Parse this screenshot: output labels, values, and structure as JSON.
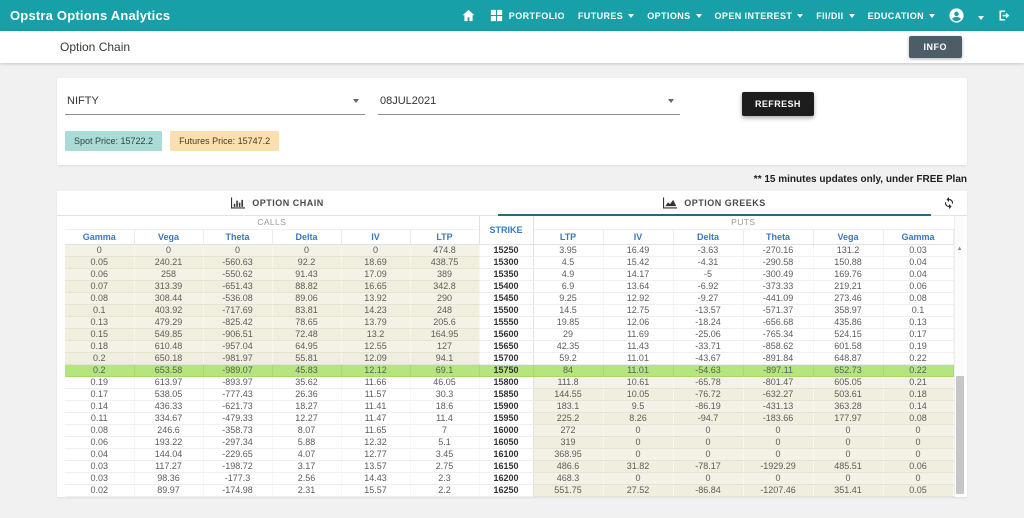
{
  "navbar": {
    "brand": "Opstra Options Analytics",
    "items": [
      {
        "label": "PORTFOLIO"
      },
      {
        "label": "FUTURES"
      },
      {
        "label": "OPTIONS"
      },
      {
        "label": "OPEN INTEREST"
      },
      {
        "label": "FII/DII"
      },
      {
        "label": "EDUCATION"
      }
    ]
  },
  "header": {
    "title": "Option Chain",
    "info_button": "INFO"
  },
  "filters": {
    "symbol": "NIFTY",
    "expiry": "08JUL2021",
    "refresh_button": "REFRESH",
    "spot_badge": "Spot Price: 15722.2",
    "futures_badge": "Futures Price: 15747.2"
  },
  "note": "** 15 minutes updates only, under FREE Plan",
  "tabs": {
    "option_chain": "OPTION CHAIN",
    "option_greeks": "OPTION GREEKS"
  },
  "table": {
    "group_headers": {
      "calls": "CALLS",
      "strike": "STRIKE",
      "puts": "PUTS"
    },
    "calls_columns": [
      "Gamma",
      "Vega",
      "Theta",
      "Delta",
      "IV",
      "LTP"
    ],
    "puts_columns": [
      "LTP",
      "IV",
      "Delta",
      "Theta",
      "Vega",
      "Gamma"
    ],
    "rows": [
      {
        "strike": "15250",
        "calls": [
          "0",
          "0",
          "0",
          "0",
          "0",
          "474.8"
        ],
        "puts": [
          "3.95",
          "16.49",
          "-3.63",
          "-270.16",
          "131.2",
          "0.03"
        ],
        "state": "calls_itm"
      },
      {
        "strike": "15300",
        "calls": [
          "0.05",
          "240.21",
          "-560.63",
          "92.2",
          "18.69",
          "438.75"
        ],
        "puts": [
          "4.5",
          "15.42",
          "-4.31",
          "-290.58",
          "150.88",
          "0.04"
        ],
        "state": "calls_itm"
      },
      {
        "strike": "15350",
        "calls": [
          "0.06",
          "258",
          "-550.62",
          "91.43",
          "17.09",
          "389"
        ],
        "puts": [
          "4.9",
          "14.17",
          "-5",
          "-300.49",
          "169.76",
          "0.04"
        ],
        "state": "calls_itm"
      },
      {
        "strike": "15400",
        "calls": [
          "0.07",
          "313.39",
          "-651.43",
          "88.82",
          "16.65",
          "342.8"
        ],
        "puts": [
          "6.9",
          "13.64",
          "-6.92",
          "-373.33",
          "219.21",
          "0.06"
        ],
        "state": "calls_itm"
      },
      {
        "strike": "15450",
        "calls": [
          "0.08",
          "308.44",
          "-536.08",
          "89.06",
          "13.92",
          "290"
        ],
        "puts": [
          "9.25",
          "12.92",
          "-9.27",
          "-441.09",
          "273.46",
          "0.08"
        ],
        "state": "calls_itm"
      },
      {
        "strike": "15500",
        "calls": [
          "0.1",
          "403.92",
          "-717.69",
          "83.81",
          "14.23",
          "248"
        ],
        "puts": [
          "14.5",
          "12.75",
          "-13.57",
          "-571.37",
          "358.97",
          "0.1"
        ],
        "state": "calls_itm"
      },
      {
        "strike": "15550",
        "calls": [
          "0.13",
          "479.29",
          "-825.42",
          "78.65",
          "13.79",
          "205.6"
        ],
        "puts": [
          "19.85",
          "12.06",
          "-18.24",
          "-656.68",
          "435.86",
          "0.13"
        ],
        "state": "calls_itm"
      },
      {
        "strike": "15600",
        "calls": [
          "0.15",
          "549.85",
          "-906.51",
          "72.48",
          "13.2",
          "164.95"
        ],
        "puts": [
          "29",
          "11.69",
          "-25.06",
          "-765.34",
          "524.15",
          "0.17"
        ],
        "state": "calls_itm"
      },
      {
        "strike": "15650",
        "calls": [
          "0.18",
          "610.48",
          "-957.04",
          "64.95",
          "12.55",
          "127"
        ],
        "puts": [
          "42.35",
          "11.43",
          "-33.71",
          "-858.62",
          "601.58",
          "0.19"
        ],
        "state": "calls_itm"
      },
      {
        "strike": "15700",
        "calls": [
          "0.2",
          "650.18",
          "-981.97",
          "55.81",
          "12.09",
          "94.1"
        ],
        "puts": [
          "59.2",
          "11.01",
          "-43.67",
          "-891.84",
          "648.87",
          "0.22"
        ],
        "state": "calls_itm"
      },
      {
        "strike": "15750",
        "calls": [
          "0.2",
          "653.58",
          "-989.07",
          "45.83",
          "12.12",
          "69.1"
        ],
        "puts": [
          "84",
          "11.01",
          "-54.63",
          "-897.11",
          "652.73",
          "0.22"
        ],
        "state": "atm"
      },
      {
        "strike": "15800",
        "calls": [
          "0.19",
          "613.97",
          "-893.97",
          "35.62",
          "11.66",
          "46.05"
        ],
        "puts": [
          "111.8",
          "10.61",
          "-65.78",
          "-801.47",
          "605.05",
          "0.21"
        ],
        "state": "puts_itm"
      },
      {
        "strike": "15850",
        "calls": [
          "0.17",
          "538.05",
          "-777.43",
          "26.36",
          "11.57",
          "30.3"
        ],
        "puts": [
          "144.55",
          "10.05",
          "-76.72",
          "-632.27",
          "503.61",
          "0.18"
        ],
        "state": "puts_itm"
      },
      {
        "strike": "15900",
        "calls": [
          "0.14",
          "436.33",
          "-621.73",
          "18.27",
          "11.41",
          "18.6"
        ],
        "puts": [
          "183.1",
          "9.5",
          "-86.19",
          "-431.13",
          "363.28",
          "0.14"
        ],
        "state": "puts_itm"
      },
      {
        "strike": "15950",
        "calls": [
          "0.11",
          "334.67",
          "-479.33",
          "12.27",
          "11.47",
          "11.4"
        ],
        "puts": [
          "225.2",
          "8.26",
          "-94.7",
          "-183.66",
          "177.97",
          "0.08"
        ],
        "state": "puts_itm"
      },
      {
        "strike": "16000",
        "calls": [
          "0.08",
          "246.6",
          "-358.73",
          "8.07",
          "11.65",
          "7"
        ],
        "puts": [
          "272",
          "0",
          "0",
          "0",
          "0",
          "0"
        ],
        "state": "puts_itm"
      },
      {
        "strike": "16050",
        "calls": [
          "0.06",
          "193.22",
          "-297.34",
          "5.88",
          "12.32",
          "5.1"
        ],
        "puts": [
          "319",
          "0",
          "0",
          "0",
          "0",
          "0"
        ],
        "state": "puts_itm"
      },
      {
        "strike": "16100",
        "calls": [
          "0.04",
          "144.04",
          "-229.65",
          "4.07",
          "12.77",
          "3.45"
        ],
        "puts": [
          "368.95",
          "0",
          "0",
          "0",
          "0",
          "0"
        ],
        "state": "puts_itm"
      },
      {
        "strike": "16150",
        "calls": [
          "0.03",
          "117.27",
          "-198.72",
          "3.17",
          "13.57",
          "2.75"
        ],
        "puts": [
          "486.6",
          "31.82",
          "-78.17",
          "-1929.29",
          "485.51",
          "0.06"
        ],
        "state": "puts_itm"
      },
      {
        "strike": "16200",
        "calls": [
          "0.03",
          "98.36",
          "-177.3",
          "2.56",
          "14.43",
          "2.3"
        ],
        "puts": [
          "468.3",
          "0",
          "0",
          "0",
          "0",
          "0"
        ],
        "state": "puts_itm"
      },
      {
        "strike": "16250",
        "calls": [
          "0.02",
          "89.97",
          "-174.98",
          "2.31",
          "15.57",
          "2.2"
        ],
        "puts": [
          "551.75",
          "27.52",
          "-86.84",
          "-1207.46",
          "351.41",
          "0.05"
        ],
        "state": "puts_itm"
      }
    ]
  },
  "colors": {
    "navbar_bg": "#18a0a8",
    "atm_row": "#b5e67e",
    "itm_cell": "#f0eedd",
    "accent_blue": "#3a78c2",
    "spot_badge_bg": "#a9dcd6",
    "futures_badge_bg": "#fcdfae",
    "tab_underline": "#25697d",
    "dark_button": "#1d1d1d",
    "info_button": "#4d5d68"
  }
}
